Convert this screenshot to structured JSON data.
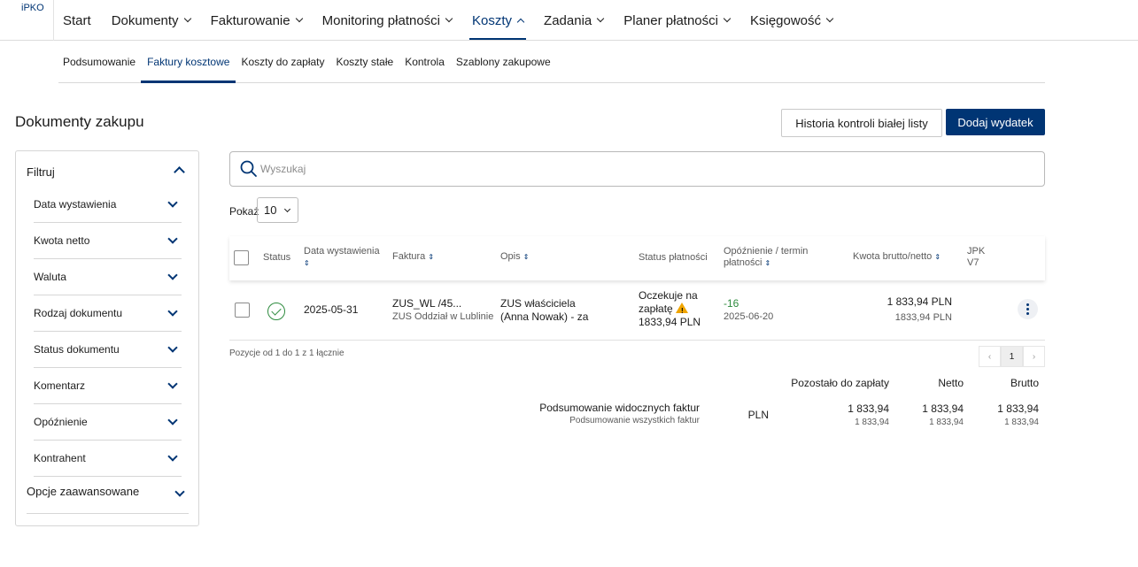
{
  "app": {
    "logo": "iPKO"
  },
  "nav": {
    "items": [
      {
        "label": "Start",
        "chevron": false
      },
      {
        "label": "Dokumenty",
        "chevron": true
      },
      {
        "label": "Fakturowanie",
        "chevron": true
      },
      {
        "label": "Monitoring płatności",
        "chevron": true
      },
      {
        "label": "Koszty",
        "chevron": true,
        "active": true
      },
      {
        "label": "Zadania",
        "chevron": true
      },
      {
        "label": "Planer płatności",
        "chevron": true
      },
      {
        "label": "Księgowość",
        "chevron": true
      }
    ]
  },
  "subnav": {
    "items": [
      {
        "label": "Podsumowanie"
      },
      {
        "label": "Faktury kosztowe",
        "active": true
      },
      {
        "label": "Koszty do zapłaty"
      },
      {
        "label": "Koszty stałe"
      },
      {
        "label": "Kontrola"
      },
      {
        "label": "Szablony zakupowe"
      }
    ]
  },
  "page": {
    "title": "Dokumenty zakupu",
    "history_button": "Historia kontroli białej listy",
    "add_button": "Dodaj wydatek"
  },
  "filters": {
    "title": "Filtruj",
    "items": [
      "Data wystawienia",
      "Kwota netto",
      "Waluta",
      "Rodzaj dokumentu",
      "Status dokumentu",
      "Komentarz",
      "Opóźnienie",
      "Kontrahent"
    ],
    "advanced": "Opcje zaawansowane"
  },
  "search": {
    "placeholder": "Wyszukaj",
    "value": ""
  },
  "pagesize": {
    "label": "Pokaż",
    "value": "10"
  },
  "table": {
    "columns": {
      "status": "Status",
      "date": "Data wystawienia",
      "invoice": "Faktura",
      "desc": "Opis",
      "payment_status": "Status płatności",
      "delay": "Opóźnienie / termin płatności",
      "amount": "Kwota brutto/netto",
      "jpk": "JPK V7"
    },
    "sort_icon": "⇕",
    "rows": [
      {
        "date": "2025-05-31",
        "invoice_no": "ZUS_WL /45...",
        "contractor": "ZUS Oddział w Lublinie",
        "desc_line1": "ZUS właściciela",
        "desc_line2": "(Anna Nowak) - za",
        "payment_status_line1": "Oczekuje na",
        "payment_status_line2": "zapłatę",
        "payment_amount": "1833,94 PLN",
        "delay_days": "-16",
        "due_date": "2025-06-20",
        "gross": "1 833,94 PLN",
        "net": "1833,94 PLN"
      }
    ]
  },
  "pagination": {
    "summary": "Pozycje od 1 do 1 z 1 łącznie",
    "prev": "‹",
    "current": "1",
    "next": "›"
  },
  "summary": {
    "headers": {
      "remaining": "Pozostało do zapłaty",
      "net": "Netto",
      "gross": "Brutto"
    },
    "visible_label": "Podsumowanie widocznych faktur",
    "all_label": "Podsumowanie wszystkich faktur",
    "currency": "PLN",
    "visible": {
      "remaining": "1 833,94",
      "net": "1 833,94",
      "gross": "1 833,94"
    },
    "all": {
      "remaining": "1 833,94",
      "net": "1 833,94",
      "gross": "1 833,94"
    }
  },
  "colors": {
    "brand": "#003574",
    "success": "#2e8b3e",
    "warning": "#f0a500",
    "delay_positive": "#2e8b3e"
  }
}
